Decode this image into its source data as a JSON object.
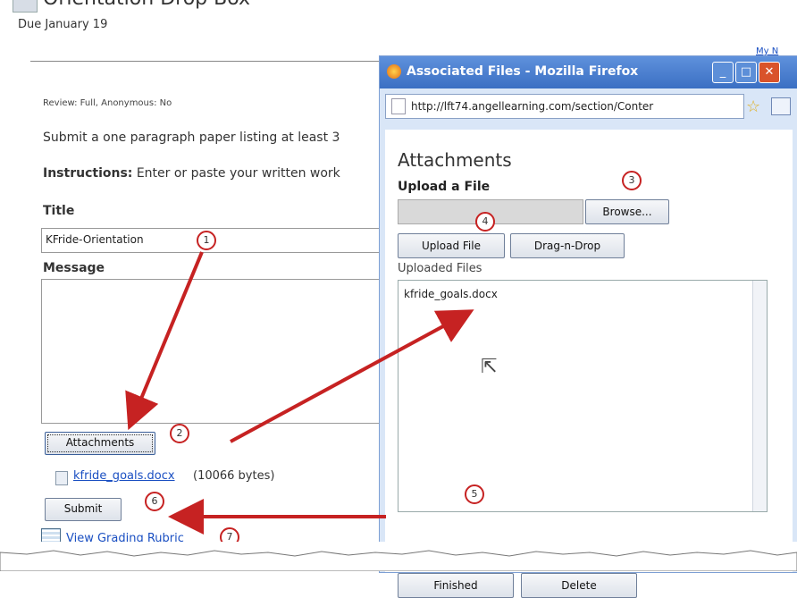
{
  "main": {
    "title": "Orientation Drop Box",
    "due": "Due January 19",
    "corner_link": "My N",
    "review": "Review: Full, Anonymous: No",
    "instructions_text": "Submit a one paragraph paper listing at least 3",
    "instructions_label": "Instructions:",
    "instructions_rest": " Enter or paste your written work",
    "title_label": "Title",
    "title_value": "KFride-Orientation",
    "message_label": "Message",
    "attachments_button": "Attachments",
    "file_link": "kfride_goals.docx",
    "file_size": "(10066 bytes)",
    "submit_button": "Submit",
    "rubric_link": "View Grading Rubric"
  },
  "popup": {
    "window_title": "Associated Files - Mozilla Firefox",
    "url": "http://lft74.angellearning.com/section/Conter",
    "heading": "Attachments",
    "upload_label": "Upload a File",
    "browse_button": "Browse...",
    "upload_button": "Upload File",
    "drag_button": "Drag-n-Drop",
    "uploaded_label": "Uploaded Files",
    "uploaded_files": [
      "kfride_goals.docx"
    ],
    "finished_button": "Finished",
    "delete_button": "Delete"
  },
  "callouts": [
    "1",
    "2",
    "3",
    "4",
    "5",
    "6",
    "7"
  ],
  "colors": {
    "arrow": "#c62222",
    "titlebar": "#3a6fc3",
    "link": "#1a4fc2"
  }
}
